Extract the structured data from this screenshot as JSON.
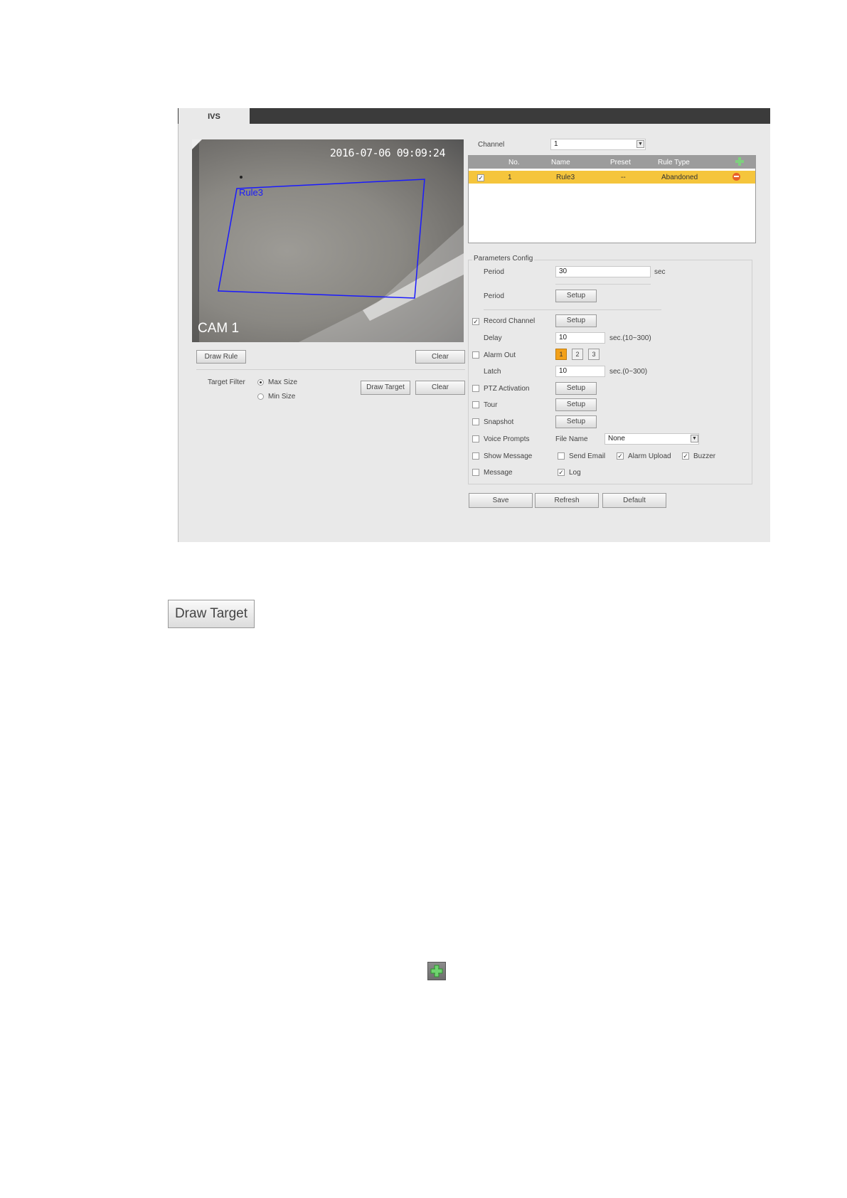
{
  "tab": "IVS",
  "video": {
    "timestamp": "2016-07-06 09:09:24",
    "camera_label": "CAM 1",
    "rule_label": "Rule3"
  },
  "video_buttons": {
    "draw_rule": "Draw Rule",
    "clear1": "Clear",
    "draw_target": "Draw Target",
    "clear2": "Clear"
  },
  "target_filter": {
    "label": "Target Filter",
    "max": "Max Size",
    "min": "Min Size"
  },
  "channel": {
    "label": "Channel",
    "value": "1"
  },
  "rule_table": {
    "headers": [
      "No.",
      "Name",
      "Preset",
      "Rule Type"
    ],
    "row": {
      "no": "1",
      "name": "Rule3",
      "preset": "--",
      "type": "Abandoned"
    }
  },
  "params": {
    "legend": "Parameters Config",
    "period_label": "Period",
    "period_value": "30",
    "period_unit": "sec",
    "period2_label": "Period",
    "setup": "Setup",
    "record_channel": "Record Channel",
    "delay_label": "Delay",
    "delay_value": "10",
    "delay_unit": "sec.(10~300)",
    "alarm_out": "Alarm Out",
    "alarm_nums": [
      "1",
      "2",
      "3"
    ],
    "latch_label": "Latch",
    "latch_value": "10",
    "latch_unit": "sec.(0~300)",
    "ptz": "PTZ Activation",
    "tour": "Tour",
    "snapshot": "Snapshot",
    "voice": "Voice Prompts",
    "file_name_label": "File Name",
    "file_name_value": "None",
    "show_message": "Show Message",
    "send_email": "Send Email",
    "alarm_upload": "Alarm Upload",
    "buzzer": "Buzzer",
    "message": "Message",
    "log": "Log"
  },
  "bottom_buttons": {
    "save": "Save",
    "refresh": "Refresh",
    "default": "Default"
  },
  "standalone_button": "Draw Target",
  "colors": {
    "accent_row": "#f5c53c",
    "rule_line": "#1a1aff",
    "add_icon": "#3aa33a"
  }
}
